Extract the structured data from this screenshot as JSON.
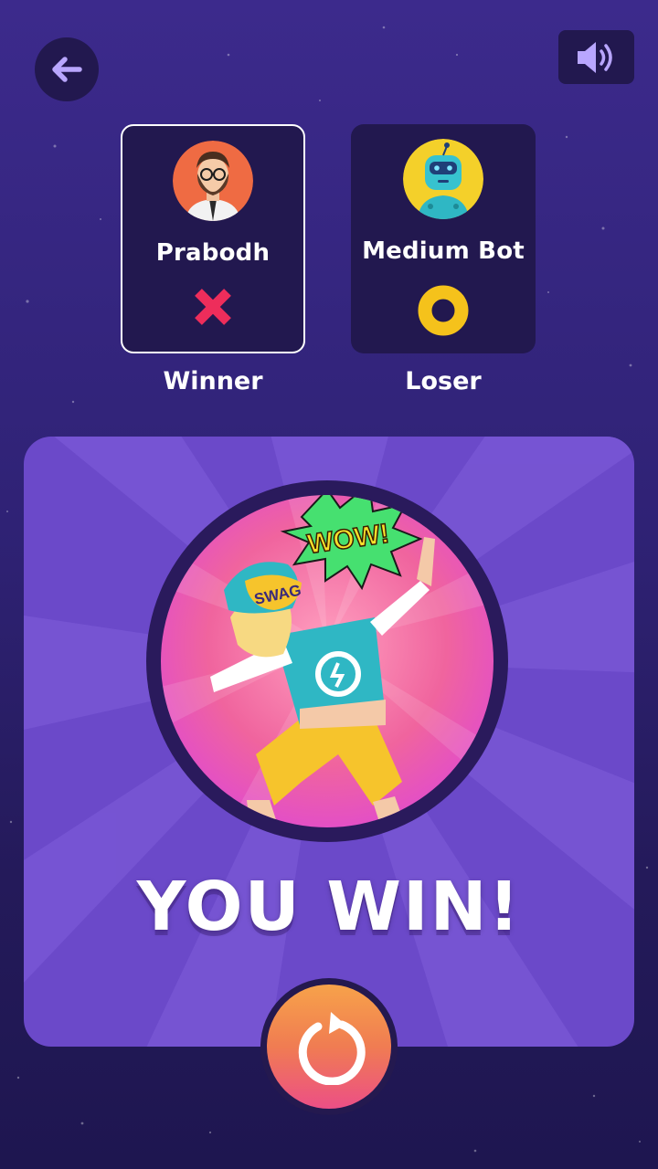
{
  "header": {
    "back_icon": "arrow-left-icon",
    "sound_icon": "speaker-volume-icon"
  },
  "players": [
    {
      "name": "Prabodh",
      "symbol": "cross",
      "result": "Winner",
      "avatar": "man-glasses-beard-avatar",
      "highlighted": true
    },
    {
      "name": "Medium Bot",
      "symbol": "circle",
      "result": "Loser",
      "avatar": "robot-avatar",
      "highlighted": false
    }
  ],
  "banner": {
    "title": "YOU WIN!",
    "illustration": "dab-dance-celebration",
    "cap_text": "SWAG",
    "burst_text": "WOW!"
  },
  "replay": {
    "icon": "replay-icon"
  },
  "colors": {
    "background": "#2f2275",
    "card": "#22184f",
    "panel": "#6b49c9",
    "cross": "#ee2d5b",
    "circle": "#f5c21b"
  }
}
